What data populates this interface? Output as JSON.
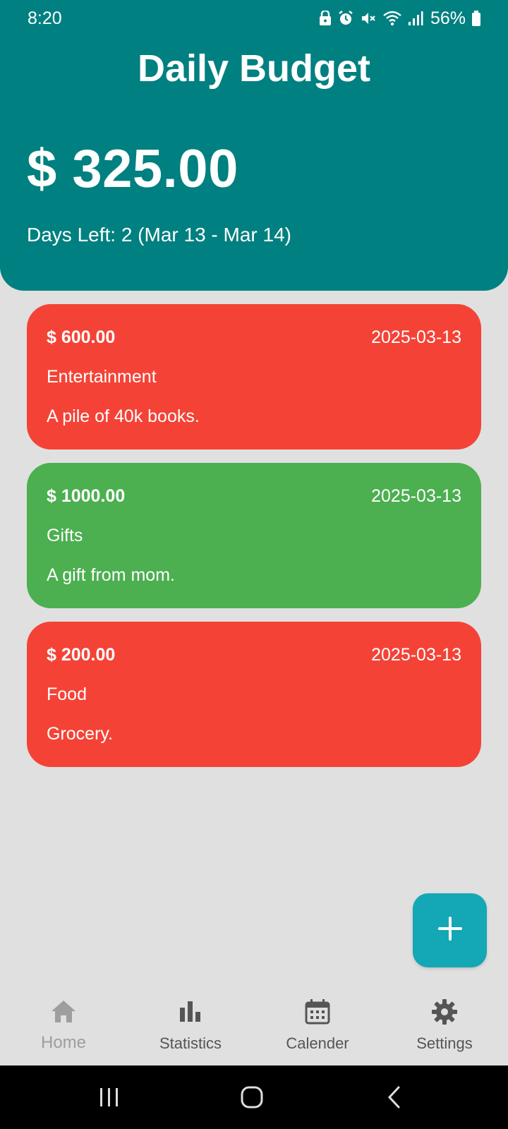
{
  "status_bar": {
    "time": "8:20",
    "battery": "56%",
    "icons": [
      "lock-icon",
      "alarm-icon",
      "mute-icon",
      "wifi-icon",
      "signal-icon",
      "battery-icon"
    ]
  },
  "header": {
    "title": "Daily Budget",
    "balance": "$ 325.00",
    "days_left": "Days Left: 2 (Mar 13 - Mar 14)",
    "color": "#008080"
  },
  "transactions": [
    {
      "type": "expense",
      "amount": "$ 600.00",
      "date": "2025-03-13",
      "category": "Entertainment",
      "note": "A pile of 40k books.",
      "color": "#f44336"
    },
    {
      "type": "income",
      "amount": "$ 1000.00",
      "date": "2025-03-13",
      "category": "Gifts",
      "note": "A gift from mom.",
      "color": "#4caf50"
    },
    {
      "type": "expense",
      "amount": "$ 200.00",
      "date": "2025-03-13",
      "category": "Food",
      "note": "Grocery.",
      "color": "#f44336"
    }
  ],
  "fab": {
    "icon": "plus-icon",
    "color": "#14a7b5"
  },
  "bottom_nav": {
    "items": [
      {
        "label": "Home",
        "icon": "home-icon",
        "active": true
      },
      {
        "label": "Statistics",
        "icon": "bar-chart-icon",
        "active": false
      },
      {
        "label": "Calender",
        "icon": "calendar-icon",
        "active": false
      },
      {
        "label": "Settings",
        "icon": "gear-icon",
        "active": false
      }
    ]
  },
  "system_nav": {
    "items": [
      "recent-apps-icon",
      "home-circle-icon",
      "back-icon"
    ]
  }
}
